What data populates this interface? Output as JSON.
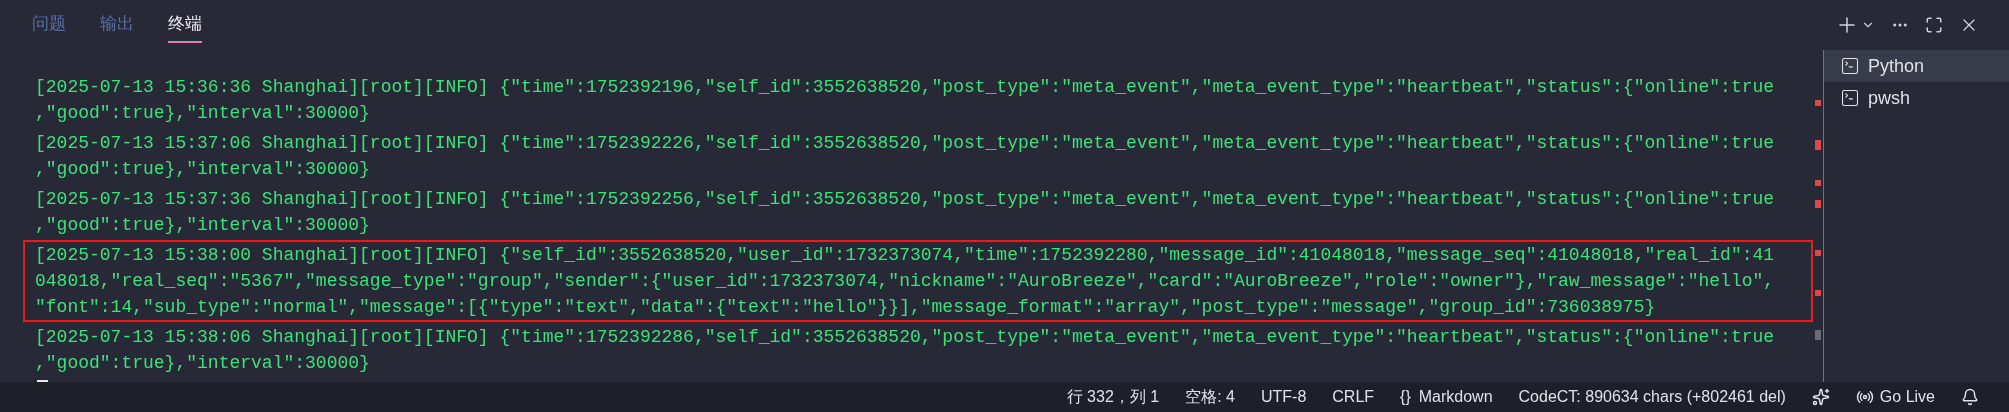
{
  "tabs": [
    {
      "label": "问题",
      "selected": false
    },
    {
      "label": "输出",
      "selected": false
    },
    {
      "label": "终端",
      "selected": true
    }
  ],
  "terminal": {
    "entries": [
      {
        "highlighted": false,
        "lines": [
          "[2025-07-13 15:36:36 Shanghai][root][INFO] {\"time\":1752392196,\"self_id\":3552638520,\"post_type\":\"meta_event\",\"meta_event_type\":\"heartbeat\",\"status\":{\"online\":true",
          ",\"good\":true},\"interval\":30000}"
        ]
      },
      {
        "highlighted": false,
        "lines": [
          "[2025-07-13 15:37:06 Shanghai][root][INFO] {\"time\":1752392226,\"self_id\":3552638520,\"post_type\":\"meta_event\",\"meta_event_type\":\"heartbeat\",\"status\":{\"online\":true",
          ",\"good\":true},\"interval\":30000}"
        ]
      },
      {
        "highlighted": false,
        "lines": [
          "[2025-07-13 15:37:36 Shanghai][root][INFO] {\"time\":1752392256,\"self_id\":3552638520,\"post_type\":\"meta_event\",\"meta_event_type\":\"heartbeat\",\"status\":{\"online\":true",
          ",\"good\":true},\"interval\":30000}"
        ]
      },
      {
        "highlighted": true,
        "lines": [
          "[2025-07-13 15:38:00 Shanghai][root][INFO] {\"self_id\":3552638520,\"user_id\":1732373074,\"time\":1752392280,\"message_id\":41048018,\"message_seq\":41048018,\"real_id\":41",
          "048018,\"real_seq\":\"5367\",\"message_type\":\"group\",\"sender\":{\"user_id\":1732373074,\"nickname\":\"AuroBreeze\",\"card\":\"AuroBreeze\",\"role\":\"owner\"},\"raw_message\":\"hello\",",
          "\"font\":14,\"sub_type\":\"normal\",\"message\":[{\"type\":\"text\",\"data\":{\"text\":\"hello\"}}],\"message_format\":\"array\",\"post_type\":\"message\",\"group_id\":736038975}"
        ]
      },
      {
        "highlighted": false,
        "lines": [
          "[2025-07-13 15:38:06 Shanghai][root][INFO] {\"time\":1752392286,\"self_id\":3552638520,\"post_type\":\"meta_event\",\"meta_event_type\":\"heartbeat\",\"status\":{\"online\":true",
          ",\"good\":true},\"interval\":30000}"
        ]
      }
    ]
  },
  "terminal_list": [
    {
      "label": "Python",
      "selected": true
    },
    {
      "label": "pwsh",
      "selected": false
    }
  ],
  "status_bar": [
    {
      "kind": "text",
      "label": "行 332，列 1"
    },
    {
      "kind": "text",
      "label": "空格: 4"
    },
    {
      "kind": "text",
      "label": "UTF-8"
    },
    {
      "kind": "text",
      "label": "CRLF"
    },
    {
      "kind": "braces",
      "glyph": "{}",
      "label": "Markdown"
    },
    {
      "kind": "text",
      "label": "CodeCT: 890634 chars (+802461 del)"
    },
    {
      "kind": "copilot"
    },
    {
      "kind": "golive",
      "label": "Go Live"
    },
    {
      "kind": "bell"
    }
  ]
}
